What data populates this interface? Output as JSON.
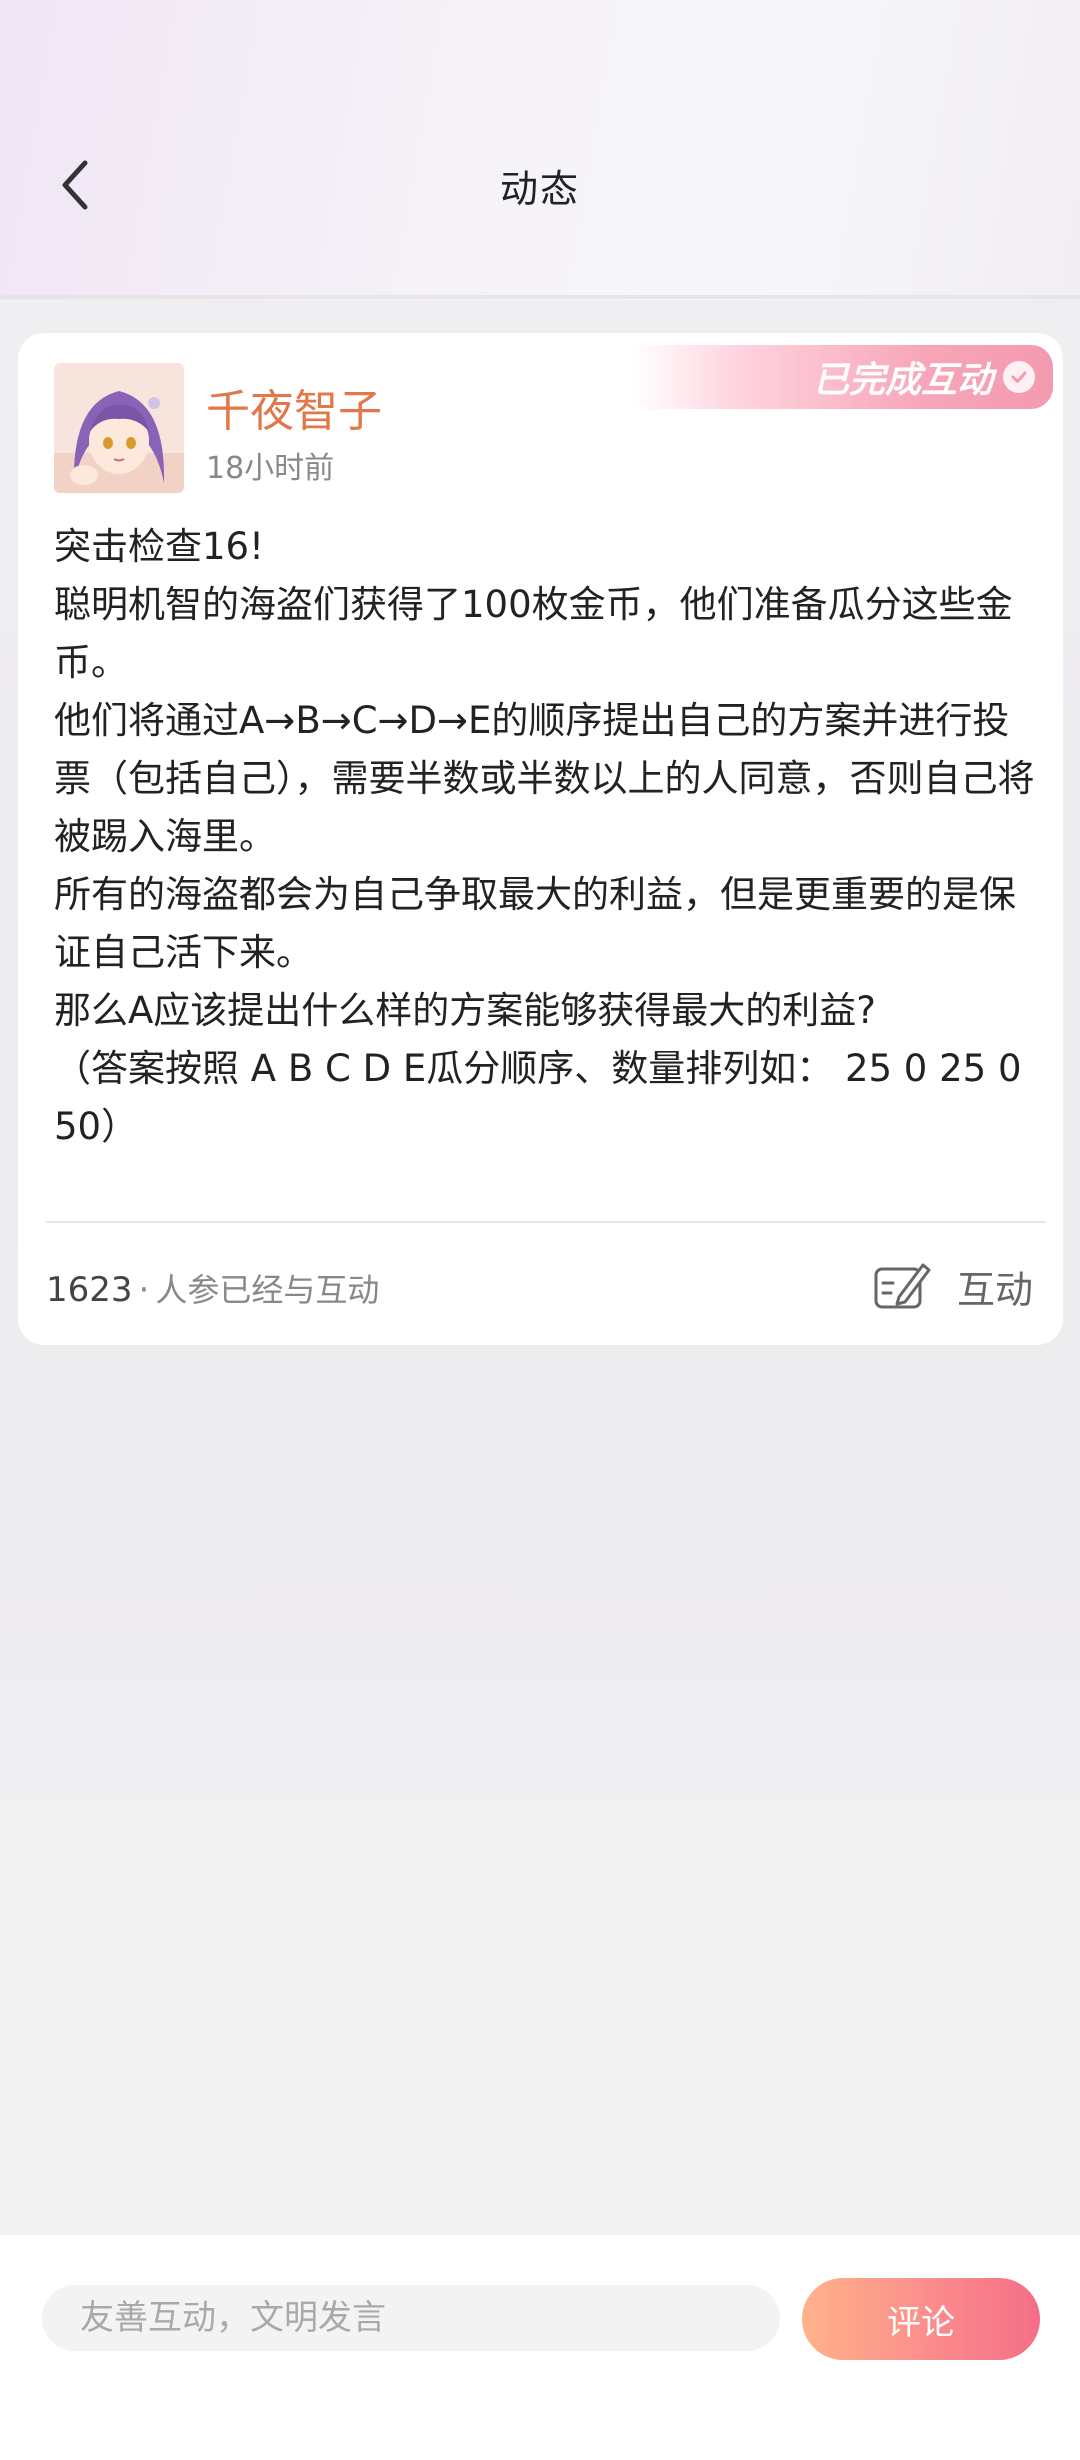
{
  "header": {
    "title": "动态",
    "back_icon": "chevron-left-icon"
  },
  "post": {
    "badge": "已完成互动",
    "author": "千夜智子",
    "time": "18小时前",
    "body": [
      "突击检查16!",
      "聪明机智的海盗们获得了100枚金币，他们准备瓜分这些金币。",
      "他们将通过A→B→C→D→E的顺序提出自己的方案并进行投票（包括自己），需要半数或半数以上的人同意，否则自己将被踢入海里。",
      "所有的海盗都会为自己争取最大的利益，但是更重要的是保证自己活下来。",
      "那么A应该提出什么样的方案能够获得最大的利益?",
      "（答案按照 A B C D E瓜分顺序、数量排列如： 25 0 25 0 50）"
    ],
    "participant_count": "1623",
    "participant_separator": "·",
    "participant_text": "人参已经与互动",
    "interact_label": "互动"
  },
  "bottom_bar": {
    "input_placeholder": "友善互动，文明发言",
    "input_value": "",
    "comment_label": "评论"
  },
  "colors": {
    "author": "#e0784a",
    "badge_gradient_end": "#f49ab0",
    "comment_button_start": "#ffb38a",
    "comment_button_end": "#f46e86"
  }
}
